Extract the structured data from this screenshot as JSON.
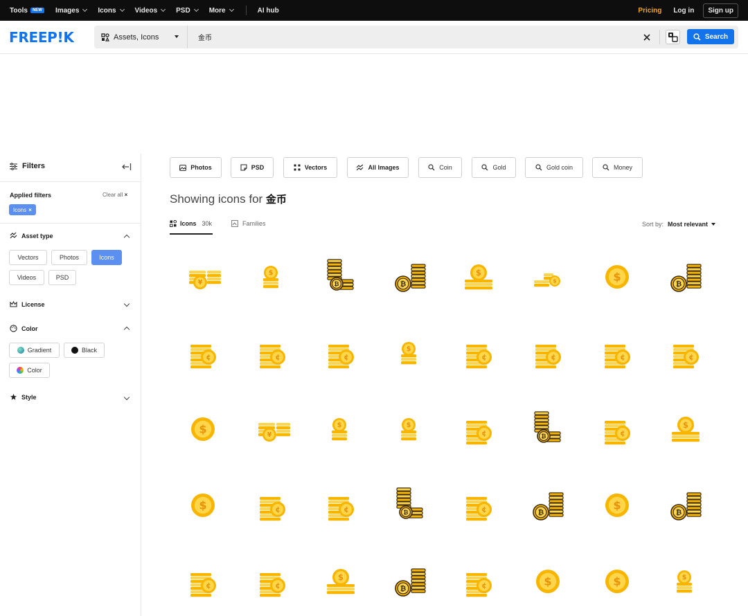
{
  "topbar": {
    "nav": [
      {
        "label": "Tools",
        "badge": "NEW"
      },
      {
        "label": "Images"
      },
      {
        "label": "Icons"
      },
      {
        "label": "Videos"
      },
      {
        "label": "PSD"
      },
      {
        "label": "More"
      }
    ],
    "ai_hub": "AI hub",
    "pricing": "Pricing",
    "login": "Log in",
    "signup": "Sign up"
  },
  "header": {
    "logo": "FREEP!K",
    "asset_type": "Assets, Icons",
    "search_value": "金币",
    "search_button": "Search"
  },
  "sidebar": {
    "title": "Filters",
    "applied_title": "Applied filters",
    "clear_all": "Clear all",
    "applied": [
      "Icons"
    ],
    "asset_type_title": "Asset type",
    "asset_types": [
      "Vectors",
      "Photos",
      "Icons",
      "Videos",
      "PSD"
    ],
    "license_title": "License",
    "color_title": "Color",
    "colors": [
      "Gradient",
      "Black",
      "Color"
    ],
    "style_title": "Style"
  },
  "chips": [
    "Photos",
    "PSD",
    "Vectors",
    "All Images",
    "Coin",
    "Gold",
    "Gold coin",
    "Money"
  ],
  "results": {
    "prefix": "Showing icons for",
    "query": "金币",
    "tab_icons": "Icons",
    "tab_icons_count": "30k",
    "tab_families": "Families",
    "sort_label": "Sort by:",
    "sort_value": "Most relevant"
  },
  "icons": [
    "coin-stack-icon",
    "coin-stack-icon",
    "coin-stack-icon",
    "coin-stack-icon",
    "coin-stack-icon",
    "coin-stack-icon",
    "coin-icon",
    "coin-stack-icon",
    "coin-stack-icon",
    "coin-stack-icon",
    "coin-stack-icon",
    "coin-stack-icon",
    "coin-stack-icon",
    "coin-stack-icon",
    "coin-stack-icon",
    "coin-stack-icon",
    "coin-icon",
    "coin-stack-icon",
    "coin-stack-icon",
    "coin-stack-icon",
    "coin-stack-icon",
    "coin-stack-icon",
    "coin-stack-icon",
    "coin-stack-icon",
    "coin-icon",
    "coin-stack-icon",
    "coin-stack-icon",
    "coin-stack-icon",
    "coin-stack-icon",
    "coin-stack-icon",
    "coin-stack-icon",
    "coin-stack-icon",
    "coin-stack-icon",
    "coin-stack-icon",
    "coin-stack-icon",
    "coin-stack-icon",
    "coin-stack-icon",
    "coin-icon",
    "coin-icon",
    "coin-stack-icon"
  ],
  "colors": {
    "brand": "#1273eb",
    "accent": "#f5a623",
    "filter_active": "#5b8ff0"
  }
}
